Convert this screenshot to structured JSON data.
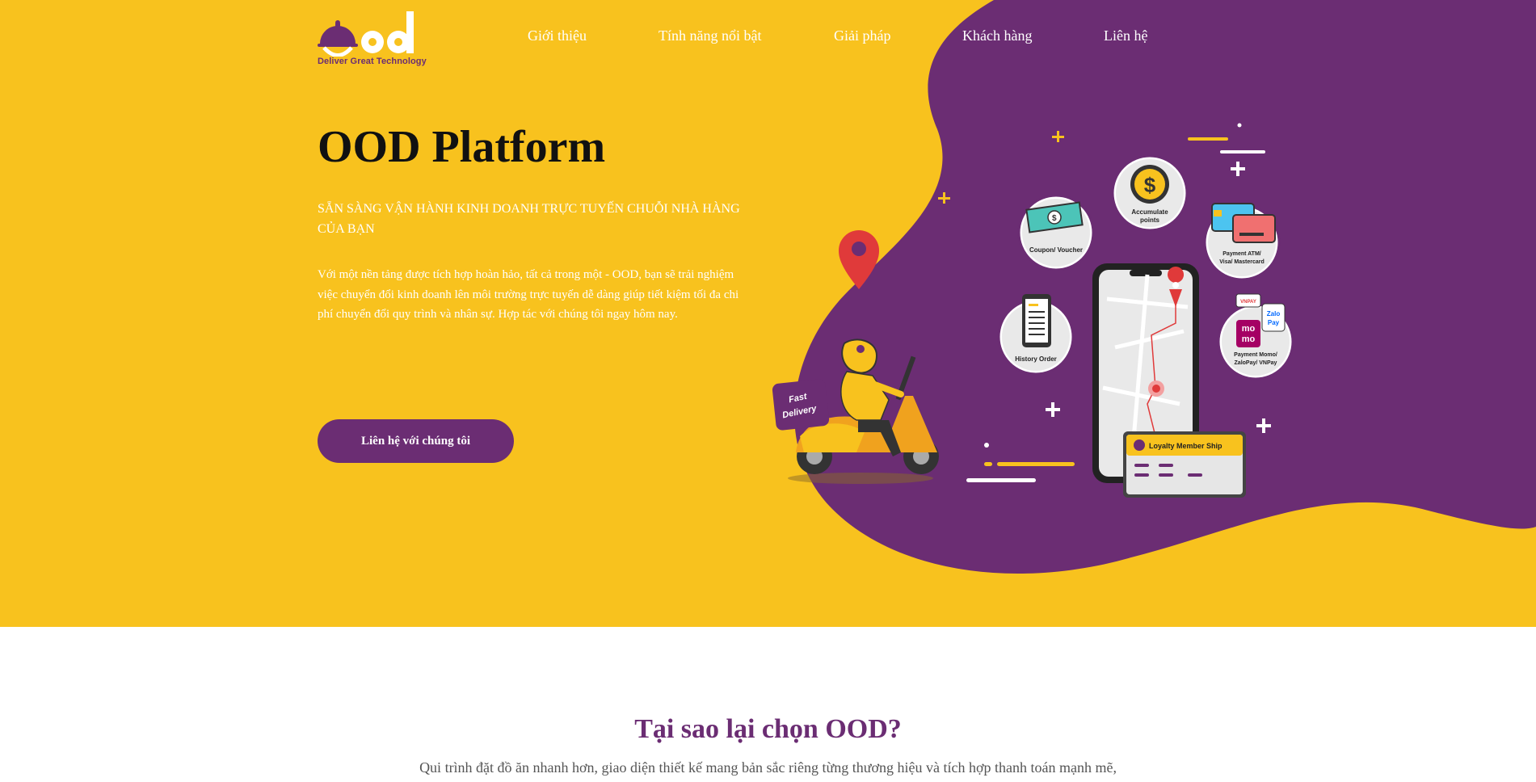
{
  "brand": {
    "name": "ood",
    "tagline": "Deliver Great Technology",
    "colors": {
      "primary": "#6B2D73",
      "accent": "#F8C21E",
      "white": "#FFFFFF"
    }
  },
  "nav": {
    "items": [
      {
        "label": "Giới thiệu"
      },
      {
        "label": "Tính năng nổi bật"
      },
      {
        "label": "Giải pháp"
      },
      {
        "label": "Khách hàng"
      },
      {
        "label": "Liên hệ"
      }
    ]
  },
  "hero": {
    "title": "OOD Platform",
    "subtitle": "SẴN SÀNG VẬN HÀNH KINH DOANH TRỰC TUYẾN CHUỖI NHÀ HÀNG CỦA BẠN",
    "description": "Với một nền tảng được tích hợp hoàn hảo, tất cả trong một - OOD, bạn sẽ trải nghiệm việc chuyển đổi kinh doanh lên môi trường trực tuyến dễ dàng giúp tiết kiệm tối đa chi phí chuyển đổi quy trình và nhân sự. Hợp tác với chúng tôi ngay hôm nay.",
    "cta_label": "Liên hệ với chúng tôi"
  },
  "illustration": {
    "features": {
      "coupon": "Coupon/ Voucher",
      "points_1": "Accumulate",
      "points_2": "points",
      "payment_card_1": "Payment ATM/",
      "payment_card_2": "Visa/ Mastercard",
      "history": "History Order",
      "payment_wallet_1": "Payment Momo/",
      "payment_wallet_2": "ZaloPay/ VNPay",
      "loyalty": "Loyalty Member Ship",
      "momo_1": "mo",
      "momo_2": "mo",
      "zalo_1": "Zalo",
      "zalo_2": "Pay",
      "vnpay": "VNPAY"
    },
    "delivery_1": "Fast",
    "delivery_2": "Delivery",
    "icons": [
      "location-pin-icon",
      "dollar-coin-icon",
      "credit-card-icon",
      "receipt-icon",
      "wallet-icon",
      "ticket-icon",
      "plus-sparkle-icon"
    ]
  },
  "why": {
    "title": "Tại sao lại chọn OOD?",
    "description": "Qui trình đặt đồ ăn nhanh hơn, giao diện thiết kế mang bản sắc riêng từng thương hiệu và tích hợp thanh toán mạnh mẽ,"
  }
}
